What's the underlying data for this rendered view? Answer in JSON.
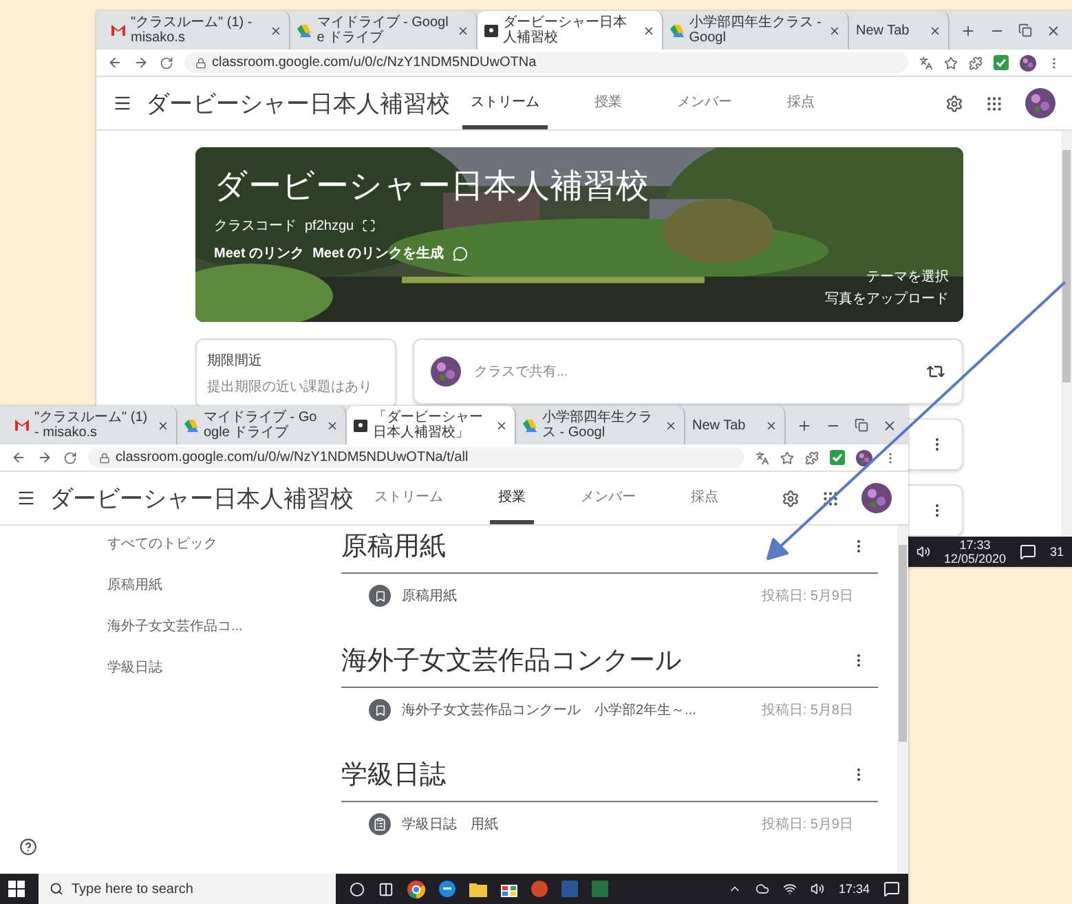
{
  "back_window": {
    "tabs": [
      {
        "label": "\"クラスルーム\" (1) - misako.s",
        "kind": "gmail",
        "selected": false
      },
      {
        "label": "マイドライブ - Google ドライブ",
        "kind": "drive",
        "selected": false
      },
      {
        "label": "ダービーシャー日本人補習校",
        "kind": "classroom",
        "selected": true
      },
      {
        "label": "小学部四年生クラス - Googl",
        "kind": "drive",
        "selected": false
      },
      {
        "label": "New Tab",
        "kind": "blank",
        "selected": false
      }
    ],
    "url": "classroom.google.com/u/0/c/NzY1NDM5NDUwOTNa",
    "app": {
      "title": "ダービーシャー日本人補習校",
      "nav": [
        {
          "label": "ストリーム",
          "selected": true
        },
        {
          "label": "授業",
          "selected": false
        },
        {
          "label": "メンバー",
          "selected": false
        },
        {
          "label": "採点",
          "selected": false
        }
      ]
    },
    "banner": {
      "title": "ダービーシャー日本人補習校",
      "class_code_label": "クラスコード",
      "class_code": "pf2hzgu",
      "meet_label": "Meet のリンク",
      "meet_link": "Meet のリンクを生成",
      "theme_link": "テーマを選択",
      "upload_link": "写真をアップロード"
    },
    "upcoming": {
      "title": "期限間近",
      "text": "提出期限の近い課題はあり"
    },
    "share": {
      "placeholder": "クラスで共有..."
    },
    "taskbar": {
      "time": "17:33",
      "date": "12/05/2020",
      "notifications": "31"
    }
  },
  "front_window": {
    "tabs": [
      {
        "label": "\"クラスルーム\" (1) - misako.s",
        "kind": "gmail",
        "selected": false
      },
      {
        "label": "マイドライブ - Google ドライブ",
        "kind": "drive",
        "selected": false
      },
      {
        "label": "「ダービーシャー日本人補習校」",
        "kind": "classroom",
        "selected": true
      },
      {
        "label": "小学部四年生クラス - Googl",
        "kind": "drive",
        "selected": false
      },
      {
        "label": "New Tab",
        "kind": "blank",
        "selected": false
      }
    ],
    "url": "classroom.google.com/u/0/w/NzY1NDM5NDUwOTNa/t/all",
    "app": {
      "title": "ダービーシャー日本人補習校",
      "nav": [
        {
          "label": "ストリーム",
          "selected": false
        },
        {
          "label": "授業",
          "selected": true
        },
        {
          "label": "メンバー",
          "selected": false
        },
        {
          "label": "採点",
          "selected": false
        }
      ]
    },
    "topics": [
      "すべてのトピック",
      "原稿用紙",
      "海外子女文芸作品コ...",
      "学級日誌"
    ],
    "sections": [
      {
        "title": "原稿用紙",
        "items": [
          {
            "title": "原稿用紙",
            "posted": "投稿日: 5月9日",
            "kind": "material"
          }
        ]
      },
      {
        "title": "海外子女文芸作品コンクール",
        "items": [
          {
            "title": "海外子女文芸作品コンクール　小学部2年生～...",
            "posted": "投稿日: 5月8日",
            "kind": "material"
          }
        ]
      },
      {
        "title": "学級日誌",
        "items": [
          {
            "title": "学級日誌　用紙",
            "posted": "投稿日: 5月9日",
            "kind": "notes"
          }
        ]
      }
    ],
    "taskbar": {
      "search_placeholder": "Type here to search",
      "time": "17:34"
    }
  }
}
